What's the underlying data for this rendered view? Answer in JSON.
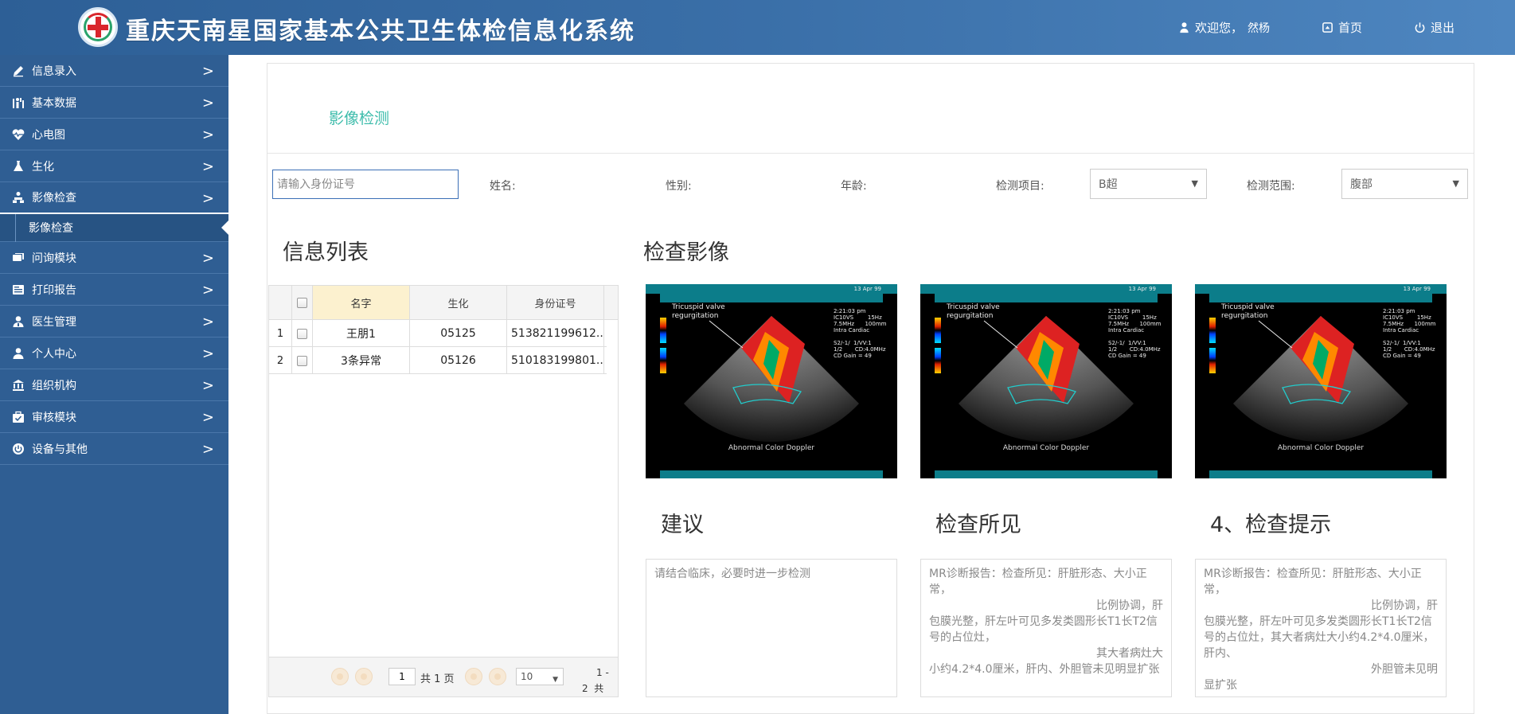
{
  "header": {
    "app_title": "重庆天南星国家基本公共卫生体检信息化系统",
    "welcome": "欢迎您，",
    "username": "然杨",
    "home_label": "首页",
    "logout_label": "退出"
  },
  "sidebar": {
    "items": [
      {
        "label": "信息录入",
        "icon": "pencil-icon"
      },
      {
        "label": "基本数据",
        "icon": "people-chart-icon"
      },
      {
        "label": "心电图",
        "icon": "heartbeat-icon"
      },
      {
        "label": "生化",
        "icon": "flask-icon"
      },
      {
        "label": "影像检查",
        "icon": "sitemap-icon"
      },
      {
        "label": "问询模块",
        "icon": "chat-icon"
      },
      {
        "label": "打印报告",
        "icon": "print-icon"
      },
      {
        "label": "医生管理",
        "icon": "doctor-icon"
      },
      {
        "label": "个人中心",
        "icon": "user-icon"
      },
      {
        "label": "组织机构",
        "icon": "institution-icon"
      },
      {
        "label": "审核模块",
        "icon": "briefcase-check-icon"
      },
      {
        "label": "设备与其他",
        "icon": "power-icon"
      }
    ],
    "active_sub": "影像检查",
    "arrow_glyph": ">"
  },
  "page": {
    "title": "影像检测"
  },
  "filters": {
    "id_placeholder": "请输入身份证号",
    "name_label": "姓名:",
    "gender_label": "性别:",
    "age_label": "年龄:",
    "exam_item_label": "检测项目:",
    "exam_item_value": "B超",
    "exam_range_label": "检测范围:",
    "exam_range_value": "腹部"
  },
  "info_list": {
    "heading": "信息列表",
    "columns": [
      "名字",
      "生化",
      "身份证号"
    ],
    "rows": [
      {
        "num": "1",
        "name": "王朋1",
        "biochem": "05125",
        "id": "513821199612..."
      },
      {
        "num": "2",
        "name": "3条异常",
        "biochem": "05126",
        "id": "510183199801..."
      }
    ],
    "pager": {
      "page_value": "1",
      "total_pages": "共 1 页",
      "page_size": "10",
      "range_a": "1 -",
      "range_b": "2  共"
    }
  },
  "images": {
    "heading": "检查影像",
    "label_text": "Tricuspid valve\nregurgitation",
    "caption": "Abnormal Color Doppler",
    "date": "13 Apr 99",
    "params": "2:21:03 pm\nIC10VS        15Hz\n7.5MHz      100mm\nIntra Cardiac\n\nS2/-1/  1/VV:1\n1/2       CD:4.0MHz\nCD Gain = 49"
  },
  "advice": {
    "heading": "建议",
    "text": "请结合临床，必要时进一步检测"
  },
  "findings": {
    "heading": "检查所见",
    "lines": [
      "MR诊断报告：检查所见：肝脏形态、大小正常，",
      "比例协调，肝",
      "包膜光整，肝左叶可见多发类圆形长T1长T2信号的占位灶，",
      "其大者病灶大",
      "小约4.2*4.0厘米，肝内、外胆管未见明显扩张"
    ]
  },
  "hints": {
    "heading": "4、检查提示",
    "lines": [
      "MR诊断报告：检查所见：肝脏形态、大小正常，",
      "比例协调，肝",
      "包膜光整，肝左叶可见多发类圆形长T1长T2信号的占位灶，其大者病灶大小约4.2*4.0厘米，肝内、",
      "外胆管未见明",
      "显扩张"
    ]
  }
}
